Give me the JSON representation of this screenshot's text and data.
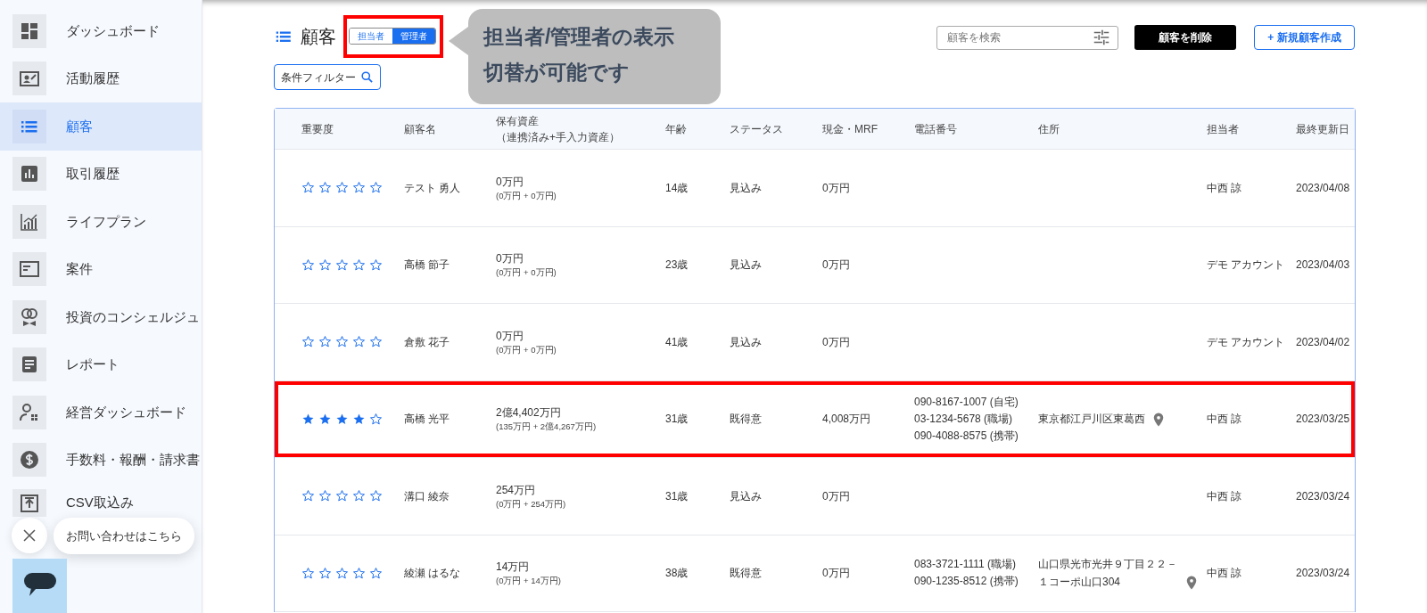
{
  "sidebar": {
    "items": [
      {
        "label": "ダッシュボード",
        "selected": false
      },
      {
        "label": "活動履歴",
        "selected": false
      },
      {
        "label": "顧客",
        "selected": true
      },
      {
        "label": "取引履歴",
        "selected": false
      },
      {
        "label": "ライフプラン",
        "selected": false
      },
      {
        "label": "案件",
        "selected": false
      },
      {
        "label": "投資のコンシェルジュ",
        "selected": false
      },
      {
        "label": "レポート",
        "selected": false
      },
      {
        "label": "経営ダッシュボード",
        "selected": false
      },
      {
        "label": "手数料・報酬・請求書",
        "selected": false
      },
      {
        "label": "CSV取込み",
        "selected": false
      }
    ]
  },
  "header": {
    "title": "顧客",
    "view_toggle": [
      {
        "label": "担当者",
        "selected": false
      },
      {
        "label": "管理者",
        "selected": true
      }
    ],
    "callout": {
      "lines": [
        "担当者/管理者の表示",
        "切替が可能です"
      ]
    },
    "filter": {
      "label": "条件フィルター"
    },
    "search": {
      "placeholder": "顧客を検索"
    },
    "buttons": [
      {
        "label": "顧客を削除",
        "kind": "dark"
      },
      {
        "label": "+ 新規顧客作成",
        "kind": "outline"
      }
    ]
  },
  "table": {
    "columns": [
      {
        "label": "重要度"
      },
      {
        "label": "顧客名"
      },
      {
        "label": "保有資産",
        "sublabel": "（連携済み+手入力資産）"
      },
      {
        "label": "年齢"
      },
      {
        "label": "ステータス"
      },
      {
        "label": "現金・MRF"
      },
      {
        "label": "電話番号"
      },
      {
        "label": "住所"
      },
      {
        "label": "担当者"
      },
      {
        "label": "最終更新日"
      }
    ],
    "rows": [
      {
        "stars": 0,
        "name": "テスト 勇人",
        "assets": "0万円",
        "assets_breakdown": "(0万円 + 0万円)",
        "age": "14歳",
        "status": "見込み",
        "cash": "0万円",
        "owner": "中西 諒",
        "updated": "2023/04/08",
        "highlighted": false
      },
      {
        "stars": 0,
        "name": "高橋 節子",
        "assets": "0万円",
        "assets_breakdown": "(0万円 + 0万円)",
        "age": "23歳",
        "status": "見込み",
        "cash": "0万円",
        "owner": "デモ アカウント",
        "updated": "2023/04/03",
        "highlighted": false
      },
      {
        "stars": 0,
        "name": "倉敷 花子",
        "assets": "0万円",
        "assets_breakdown": "(0万円 + 0万円)",
        "age": "41歳",
        "status": "見込み",
        "cash": "0万円",
        "owner": "デモ アカウント",
        "updated": "2023/04/02",
        "highlighted": false
      },
      {
        "stars": 4,
        "name": "高橋 光平",
        "assets": "2億4,402万円",
        "assets_breakdown": "(135万円 + 2億4,267万円)",
        "age": "31歳",
        "status": "既得意",
        "cash": "4,008万円",
        "phones": [
          "090-8167-1007 (自宅)",
          "03-1234-5678 (職場)",
          "090-4088-8575 (携帯)"
        ],
        "address": "東京都江戸川区東葛西",
        "owner": "中西 諒",
        "updated": "2023/03/25",
        "highlighted": true
      },
      {
        "stars": 0,
        "name": "溝口 綾奈",
        "assets": "254万円",
        "assets_breakdown": "(0万円 + 254万円)",
        "age": "31歳",
        "status": "見込み",
        "cash": "0万円",
        "owner": "中西 諒",
        "updated": "2023/03/24",
        "highlighted": false
      },
      {
        "stars": 0,
        "name": "綾瀬 はるな",
        "assets": "14万円",
        "assets_breakdown": "(0万円 + 14万円)",
        "age": "38歳",
        "status": "既得意",
        "cash": "0万円",
        "phones": [
          "083-3721-1111 (職場)",
          "090-1235-8512 (携帯)"
        ],
        "address": "山口県光市光井９丁目２２－１コーポ山口304",
        "owner": "中西 諒",
        "updated": "2023/03/24",
        "highlighted": false
      }
    ]
  },
  "chat": {
    "bubble": "お問い合わせはこちら"
  }
}
